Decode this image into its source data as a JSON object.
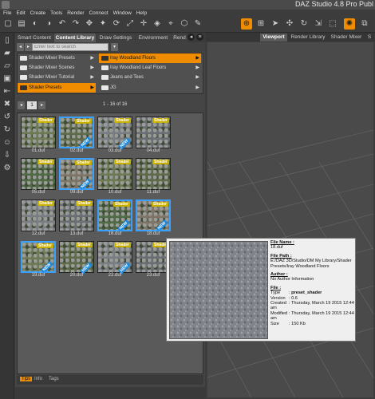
{
  "window": {
    "title": "DAZ Studio 4.8 Pro Publ"
  },
  "menu": [
    "File",
    "Edit",
    "Create",
    "Tools",
    "Render",
    "Connect",
    "Window",
    "Help"
  ],
  "panel": {
    "tabs": [
      "Smart Content",
      "Content Library",
      "Draw Settings",
      "Environment",
      "Rend"
    ],
    "active_tab": "Content Library",
    "search_placeholder": "Enter text to search",
    "tree_left": [
      "Shader Mixer Presets",
      "Shader Mixer Scenes",
      "Shader Mixer Tutorial",
      "Shader Presets"
    ],
    "tree_right": [
      "Iray Woodland Floors",
      "Iray Woodland Leaf Floors",
      "Jeans and Tees",
      "JG"
    ],
    "page": "1",
    "page_info": "1 - 16 of 16",
    "badge_label": "Shader",
    "new_label": "NEW",
    "items": [
      {
        "name": "01.duf",
        "selected": false,
        "new": false
      },
      {
        "name": "02.duf",
        "selected": true,
        "new": true
      },
      {
        "name": "03.duf",
        "selected": false,
        "new": true
      },
      {
        "name": "04.duf",
        "selected": false,
        "new": false
      },
      {
        "name": "05.duf",
        "selected": false,
        "new": false
      },
      {
        "name": "09.duf",
        "selected": true,
        "new": true
      },
      {
        "name": "10.duf",
        "selected": false,
        "new": false
      },
      {
        "name": "11.duf",
        "selected": false,
        "new": false
      },
      {
        "name": "12.duf",
        "selected": false,
        "new": false
      },
      {
        "name": "13.duf",
        "selected": false,
        "new": false
      },
      {
        "name": "16.duf",
        "selected": true,
        "new": true
      },
      {
        "name": "18.duf",
        "selected": true,
        "new": true
      },
      {
        "name": "19.duf",
        "selected": true,
        "new": true
      },
      {
        "name": "20.duf",
        "selected": false,
        "new": true
      },
      {
        "name": "22.duf",
        "selected": false,
        "new": true
      },
      {
        "name": "23.duf",
        "selected": false,
        "new": false
      }
    ],
    "bottom_tabs": [
      "Tips",
      "Info",
      "Tags"
    ]
  },
  "viewport": {
    "tabs": [
      "Viewport",
      "Render Library",
      "Shader Mixer",
      "S"
    ]
  },
  "tooltip": {
    "file_name_h": "File Name :",
    "file_name": "18.duf",
    "file_path_h": "File Path :",
    "file_path": "E:/DAZ 3D/Studio/DM My Library/Shader Presets/Iray Woodland Floors",
    "author_h": "Author :",
    "author": "No Author Information",
    "file_h": "File :",
    "type_k": "Type",
    "type_v": "preset_shader",
    "version_k": "Version",
    "version_v": "0.6",
    "created_k": "Created",
    "created_v": "Thursday, March 19 2015 12:44 am",
    "modified_k": "Modified",
    "modified_v": "Thursday, March 19 2015 12:44 am",
    "size_k": "Size",
    "size_v": "150 Kb"
  },
  "colors": {
    "accent": "#f08c00",
    "selection": "#3aa0ff",
    "badge": "#c9b000"
  }
}
